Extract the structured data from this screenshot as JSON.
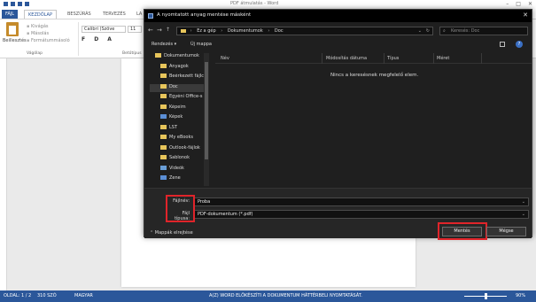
{
  "word": {
    "title": "PDF átmulatás - Word",
    "tabs": [
      "FÁJL",
      "KEZDŐLAP",
      "BESZÚRÁS",
      "TERVEZÉS",
      "LA"
    ],
    "paste_label": "Beillesztés",
    "clipboard_items": [
      "Kivágás",
      "Másolás",
      "Formátummásoló"
    ],
    "clipboard_group": "Vágólap",
    "font_name": "Calibri (Szöve",
    "font_size": "11",
    "font_group": "Betűtípus",
    "format_buttons": "F D A",
    "status_left": "OLDAL: 1 / 2",
    "status_words": "310 SZÓ",
    "status_lang": "MAGYAR",
    "status_center": "A(Z) WORD ELŐKÉSZÍTI A DOKUMENTUM HÁTTÉRBELI NYOMTATÁSÁT.",
    "zoom": "90%"
  },
  "dialog": {
    "title": "A nyomtatott anyag mentése másként",
    "close": "✕",
    "breadcrumb": [
      "Ez a gép",
      "Dokumentumok",
      "Doc"
    ],
    "search_placeholder": "Keresés: Doc",
    "organize": "Rendezés ▾",
    "new_folder": "Új mappa",
    "help": "?",
    "tree": [
      {
        "label": "Dokumentumok",
        "color": "#e7c55b"
      },
      {
        "label": "Anyagok",
        "color": "#e7c55b"
      },
      {
        "label": "Beérkezett fájlc",
        "color": "#e7c55b"
      },
      {
        "label": "Doc",
        "color": "#e7c55b",
        "selected": true
      },
      {
        "label": "Egyéni Office-s",
        "color": "#e7c55b"
      },
      {
        "label": "Képeim",
        "color": "#e7c55b"
      },
      {
        "label": "Képek",
        "color": "#5b8fd6"
      },
      {
        "label": "LST",
        "color": "#e7c55b"
      },
      {
        "label": "My eBooks",
        "color": "#e7c55b"
      },
      {
        "label": "Outlook-fájlok",
        "color": "#e7c55b"
      },
      {
        "label": "Sablonok",
        "color": "#e7c55b"
      },
      {
        "label": "Videók",
        "color": "#6a9fd8"
      },
      {
        "label": "Zene",
        "color": "#5b8fd6"
      }
    ],
    "columns": [
      "Név",
      "Módosítás dátuma",
      "Típus",
      "Méret"
    ],
    "empty_message": "Nincs a keresésnek megfelelő elem.",
    "filename_label": "Fájlnév:",
    "filename_value": "Proba",
    "filetype_label": "Fájl típusa:",
    "filetype_value": "PDF-dokumentum (*.pdf)",
    "hide_folders": "Mappák elrejtése",
    "save_button": "Mentés",
    "cancel_button": "Mégse",
    "highlight_color": "#e0242a"
  }
}
